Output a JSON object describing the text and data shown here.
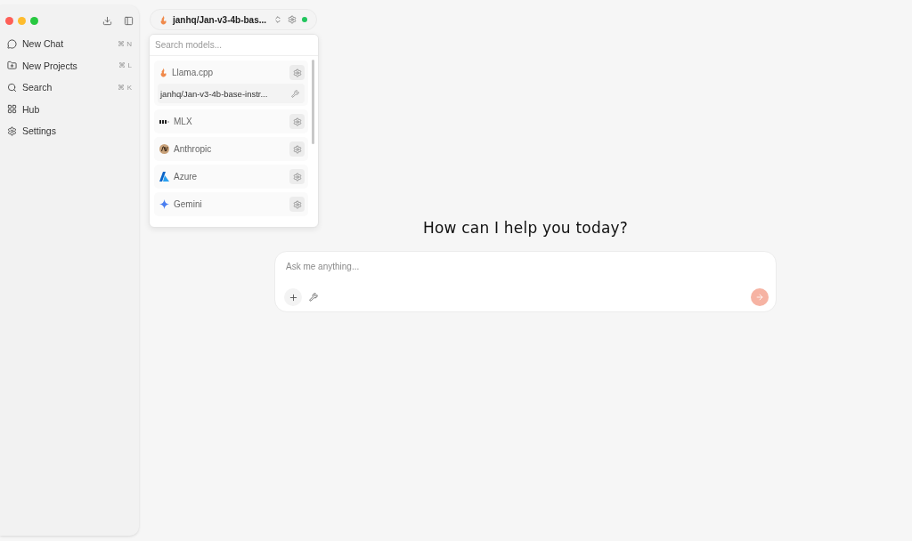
{
  "sidebar": {
    "items": [
      {
        "label": "New Chat",
        "shortcut": "⌘ N"
      },
      {
        "label": "New Projects",
        "shortcut": "⌘ L"
      },
      {
        "label": "Search",
        "shortcut": "⌘ K"
      },
      {
        "label": "Hub"
      },
      {
        "label": "Settings"
      }
    ]
  },
  "model_selector": {
    "value": "janhq/Jan-v3-4b-bas...",
    "status_dot": {
      "color": "#22c55e"
    }
  },
  "dropdown": {
    "placeholder": "Search models...",
    "providers": [
      {
        "name": "Llama.cpp",
        "models": [
          "janhq/Jan-v3-4b-base-instr..."
        ]
      },
      {
        "name": "MLX"
      },
      {
        "name": "Anthropic"
      },
      {
        "name": "Azure"
      },
      {
        "name": "Gemini"
      }
    ]
  },
  "heading": "How can I help you today?",
  "composer": {
    "placeholder": "Ask me anything..."
  }
}
